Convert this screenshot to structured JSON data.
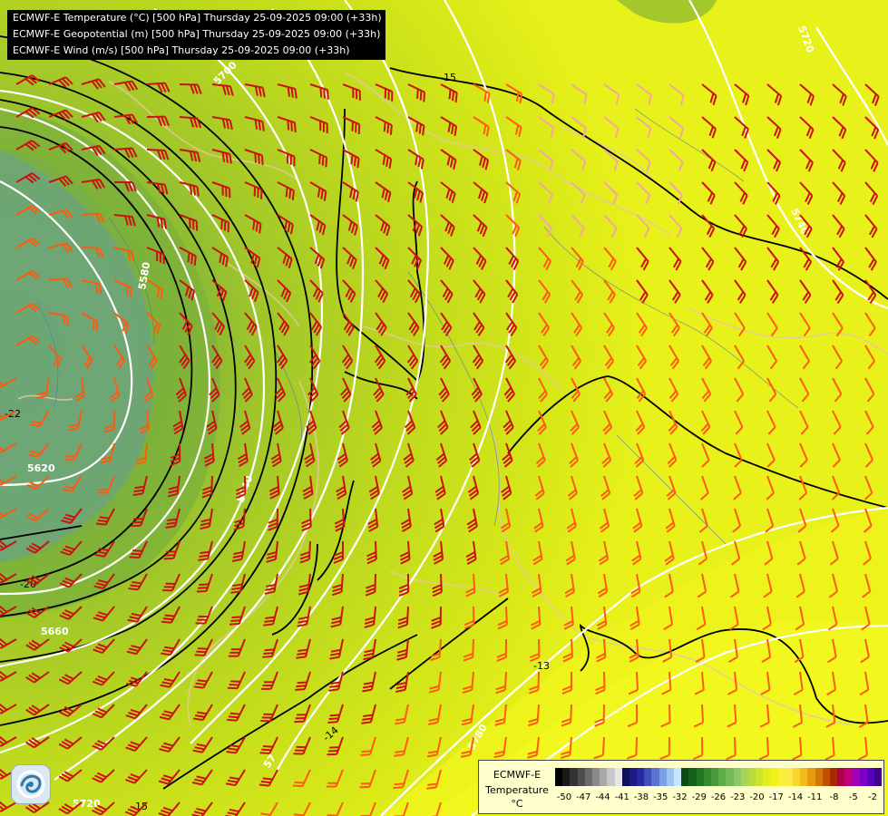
{
  "titles": [
    "ECMWF-E Temperature (°C) [500 hPa] Thursday 25-09-2025 09:00 (+33h)",
    "ECMWF-E Geopotential (m) [500 hPa] Thursday 25-09-2025 09:00 (+33h)",
    "ECMWF-E Wind (m/s) [500 hPa] Thursday 25-09-2025 09:00 (+33h)"
  ],
  "legend": {
    "model": "ECMWF-E",
    "parameter": "Temperature",
    "unit": "°C",
    "ticks": [
      "-50",
      "-47",
      "-44",
      "-41",
      "-38",
      "-35",
      "-32",
      "-29",
      "-26",
      "-23",
      "-20",
      "-17",
      "-14",
      "-11",
      "-8",
      "-5",
      "-2"
    ],
    "colors": [
      "#000000",
      "#1a1a1a",
      "#333333",
      "#4d4d4d",
      "#6b6b6b",
      "#8a8a8a",
      "#a8a8a8",
      "#c8c8c8",
      "#e6e6e6",
      "#10105a",
      "#1c1c82",
      "#2a2aa0",
      "#3c4fbd",
      "#5874d0",
      "#7aa0e2",
      "#9fc4f0",
      "#c8e4ff",
      "#0b4d12",
      "#16611a",
      "#237524",
      "#34892f",
      "#489b3c",
      "#5dac4a",
      "#74bb58",
      "#8dc866",
      "#a8d25a",
      "#b9dc3a",
      "#cde62a",
      "#e1ef22",
      "#f0f21a",
      "#f7f13a",
      "#faea46",
      "#f7d62b",
      "#f0bd1c",
      "#e69a12",
      "#d6770c",
      "#c24f08",
      "#a82a05",
      "#b0004a",
      "#c0007c",
      "#a000b0",
      "#7a00c8",
      "#5a00b8",
      "#400090"
    ],
    "tick_colors_note_visible": false
  },
  "map": {
    "temperature_contour_labels": [
      "-15",
      "-13",
      "-14",
      "-15",
      "-20",
      "-22"
    ],
    "geopotential_contour_labels": [
      "5700",
      "5720",
      "5740",
      "5580",
      "5620",
      "5660",
      "5640",
      "5660",
      "5780",
      "5720"
    ],
    "palette": {
      "cold_core": "#6fa572",
      "green_mid": "#7fb13c",
      "green_light": "#a8c92c",
      "yellow_green": "#c8dc1a",
      "yellow": "#e6ef14",
      "bright_yellow": "#f2f51c",
      "wind_barb_strong": "#cc1111",
      "wind_barb_mid": "#ff5a10",
      "wind_barb_weak": "#f2a7a0",
      "border": "#e8c8a0",
      "river": "#4a7aa8",
      "temp_contour": "#000000",
      "geo_contour": "#ffffff"
    }
  },
  "logo": {
    "icon": "weather-logo-icon"
  }
}
